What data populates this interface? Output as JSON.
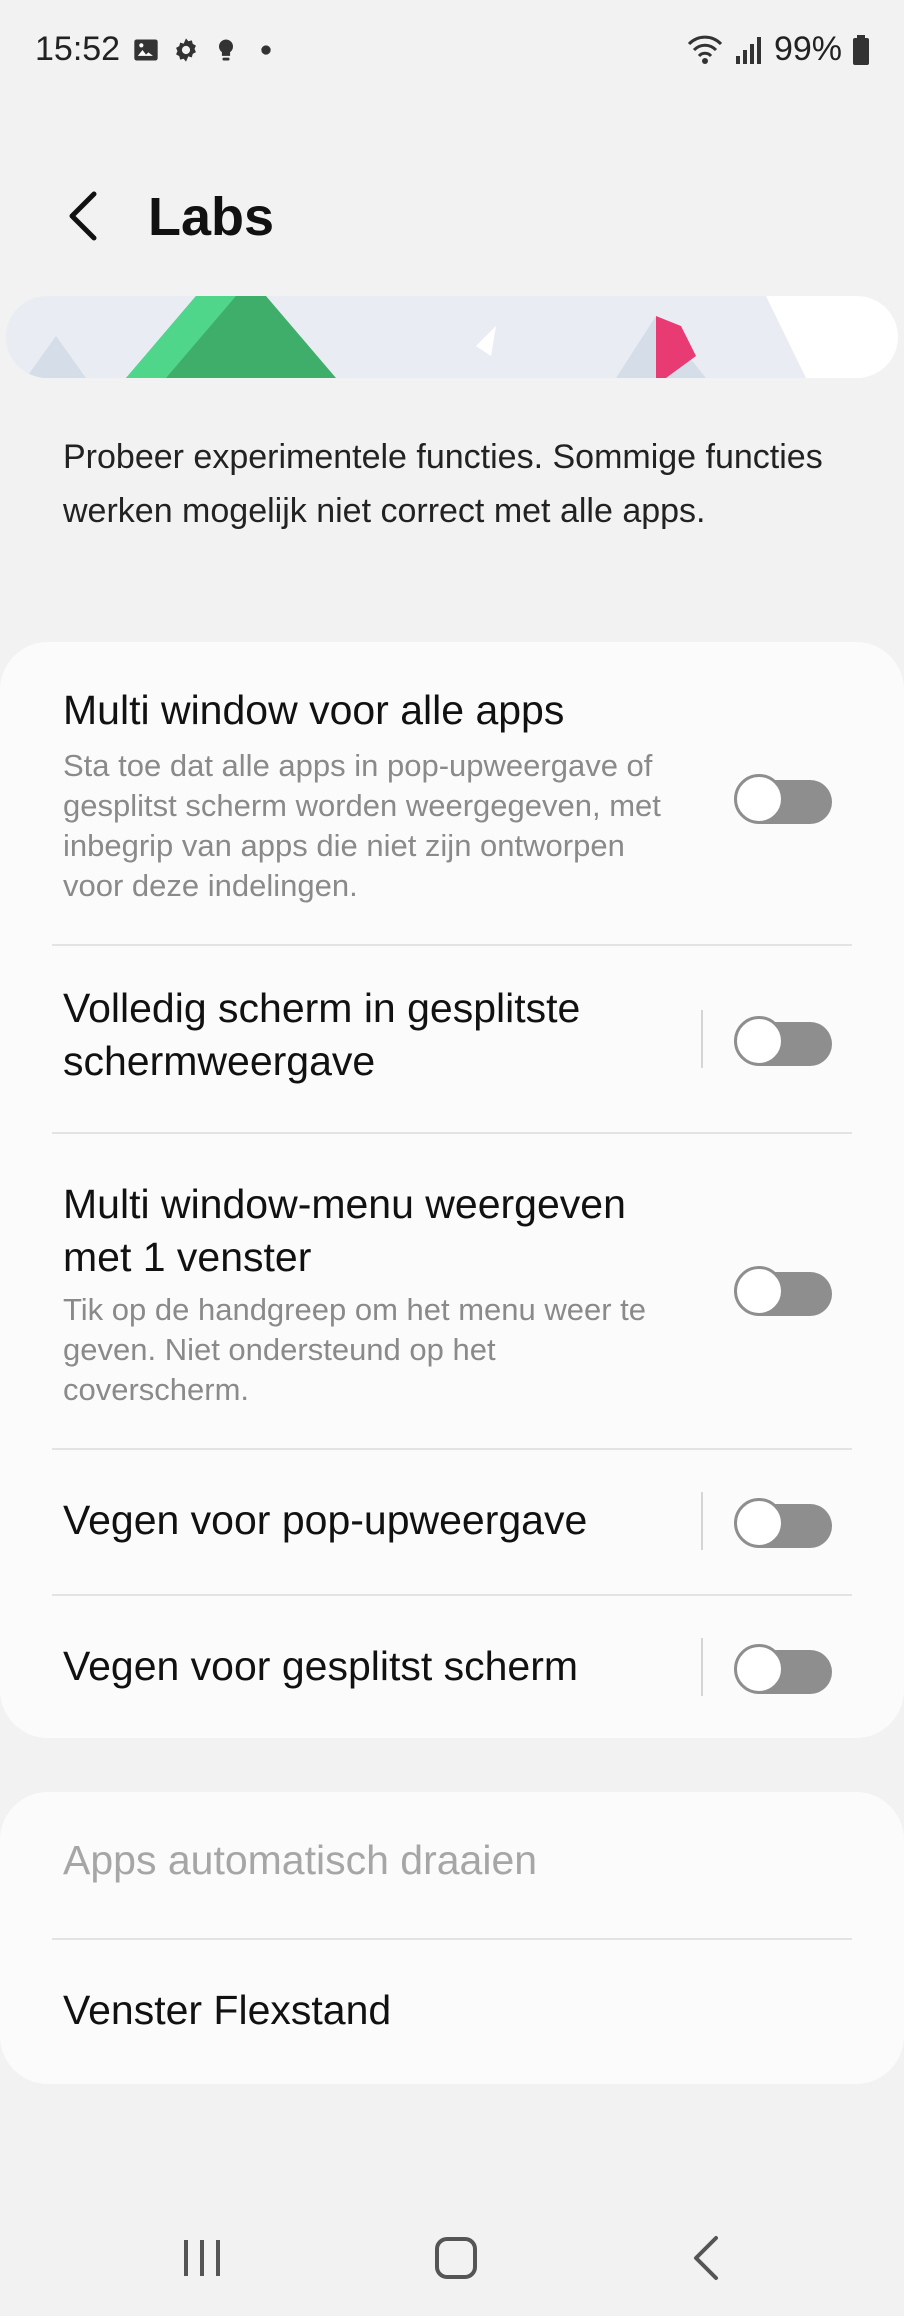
{
  "status_bar": {
    "time": "15:52",
    "left_icons": [
      "gallery-icon",
      "settings-icon",
      "tips-bulb-icon",
      "dot-icon"
    ],
    "right_icons": [
      "wifi-icon",
      "signal-icon",
      "battery-icon"
    ],
    "battery": "99%"
  },
  "header": {
    "title": "Labs",
    "back_icon": "back-chevron-icon"
  },
  "description": "Probeer experimentele functies. Sommige functies werken mogelijk niet correct met alle apps.",
  "settings": [
    {
      "title": "Multi window voor alle apps",
      "subtitle": "Sta toe dat alle apps in pop-upweergave of gesplitst scherm worden weergegeven, met inbegrip van apps die niet zijn ontworpen voor deze indelingen.",
      "enabled": false
    },
    {
      "title": "Volledig scherm in gesplitste schermweergave",
      "enabled": false
    },
    {
      "title": "Multi window-menu weergeven met 1 venster",
      "subtitle": "Tik op de handgreep om het menu weer te geven. Niet ondersteund op het coverscherm.",
      "enabled": false
    },
    {
      "title": "Vegen voor pop-upweergave",
      "enabled": false
    },
    {
      "title": "Vegen voor gesplitst scherm",
      "enabled": false
    }
  ],
  "more_settings": [
    {
      "title": "Apps automatisch draaien",
      "disabled": true
    },
    {
      "title": "Venster Flexstand",
      "disabled": false
    }
  ],
  "nav_bar": {
    "buttons": [
      "recents-icon",
      "home-icon",
      "back-icon"
    ]
  },
  "colors": {
    "background": "#f2f2f2",
    "card": "#fbfbfb",
    "toggle_off": "#8e8e8e",
    "banner_green": "#3fae6a",
    "banner_pink": "#e83b74"
  }
}
